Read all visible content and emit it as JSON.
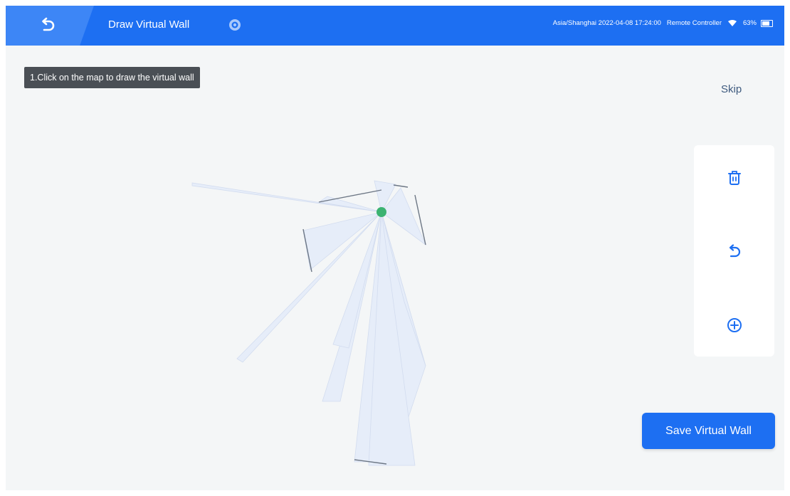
{
  "header": {
    "title": "Draw Virtual Wall",
    "timezone_datetime": "Asia/Shanghai 2022-04-08 17:24:00",
    "mode": "Remote Controller",
    "battery": "63%"
  },
  "instruction": "1.Click on the map to draw the virtual wall",
  "skip_label": "Skip",
  "tools": [
    "trash-icon",
    "undo-icon",
    "add-circle-icon"
  ],
  "save_label": "Save Virtual Wall",
  "colors": {
    "accent": "#1d6ff2",
    "robot_marker": "#3cb371",
    "map_fill": "#e6edf9"
  }
}
